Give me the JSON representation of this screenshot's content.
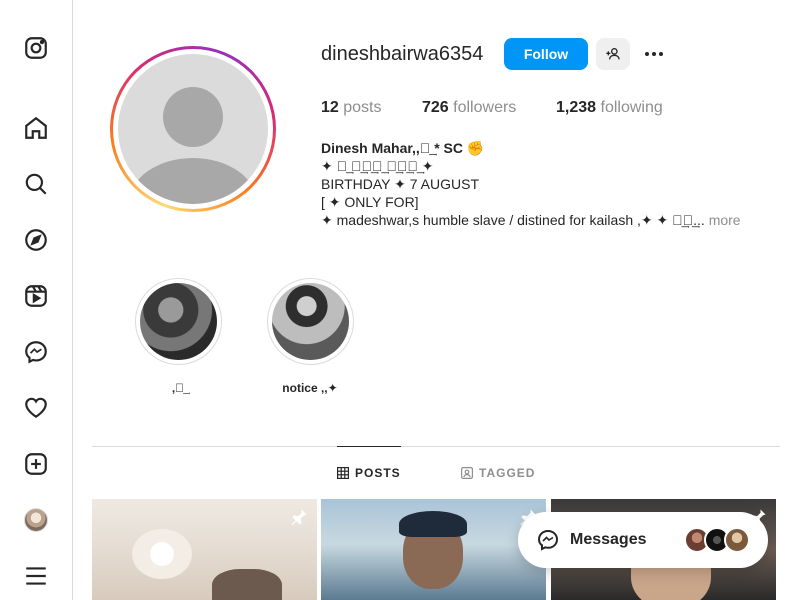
{
  "profile": {
    "username": "dineshbairwa6354",
    "follow_label": "Follow",
    "stats": {
      "posts_count": "12",
      "posts_label": "posts",
      "followers_count": "726",
      "followers_label": "followers",
      "following_count": "1,238",
      "following_label": "following"
    },
    "bio": {
      "name": "Dinesh Mahar,,ꪜ͢ * SC ✊",
      "line1": "✦ ꪜ͢ ꪜ͢ꪜ͢ꪜ͢ ꪜ͢ꪜ͢ꪜ͢ ✦",
      "line2": "BIRTHDAY ✦ 7 AUGUST",
      "line3": "[ ✦ ONLY FOR]",
      "line4": "✦ madeshwar,s humble slave / distined for kailash ,✦ ✦ ꪜ͢ꪜ͢...",
      "more_label": "more"
    }
  },
  "highlights": [
    {
      "label": ",ꪜ͢"
    },
    {
      "label": "notice ,,✦"
    }
  ],
  "tabs": {
    "posts_label": "POSTS",
    "tagged_label": "TAGGED"
  },
  "messages": {
    "label": "Messages"
  },
  "colors": {
    "accent": "#0095f6",
    "text": "#262626",
    "muted": "#8e8e8e",
    "border": "#dbdbdb"
  },
  "sidebar_icons": [
    "instagram-logo-icon",
    "home-icon",
    "search-icon",
    "explore-icon",
    "reels-icon",
    "messenger-icon",
    "heart-icon",
    "create-icon",
    "profile-avatar",
    "menu-icon"
  ]
}
